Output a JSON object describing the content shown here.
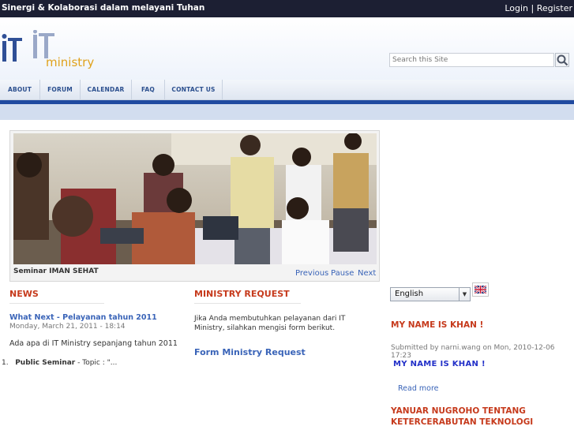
{
  "topbar": {
    "tagline": "Sinergi & Kolaborasi dalam melayani Tuhan",
    "login": "Login",
    "separator": " | ",
    "register": "Register"
  },
  "header": {
    "logo_text": "ministry",
    "search_placeholder": "Search this Site"
  },
  "nav": {
    "items": [
      "ABOUT",
      "FORUM",
      "CALENDAR",
      "FAQ",
      "CONTACT US"
    ]
  },
  "slider": {
    "caption": "Seminar IMAN SEHAT",
    "previous": "Previous",
    "pause": "Pause",
    "next": "Next"
  },
  "news": {
    "title": "NEWS",
    "item_title": "What Next - Pelayanan tahun 2011",
    "item_date": "Monday, March 21, 2011 - 18:14",
    "item_text": "Ada apa di IT Ministry sepanjang tahun 2011",
    "list_number": "1.",
    "list_bold": "Public Seminar",
    "list_rest": " - Topic : \"..."
  },
  "ministry_request": {
    "title": "MINISTRY REQUEST",
    "text": "Jika Anda membutuhkan pelayanan dari IT Ministry, silahkan mengisi form berikut.",
    "link": "Form Ministry Request"
  },
  "sidebar": {
    "language": "English",
    "post1_title": "MY NAME IS KHAN !",
    "post1_meta": "Submitted by narni.wang on Mon, 2010-12-06 17:23",
    "post1_body": "MY NAME IS KHAN !",
    "read_more": "Read more",
    "post2_title": "YANUAR NUGROHO TENTANG KETERCERABUTAN TEKNOLOGI"
  },
  "colors": {
    "topbar": "#1c1f33",
    "accent_blue": "#1f4aa0",
    "section_title": "#c63a1c",
    "link": "#3a64b8"
  }
}
